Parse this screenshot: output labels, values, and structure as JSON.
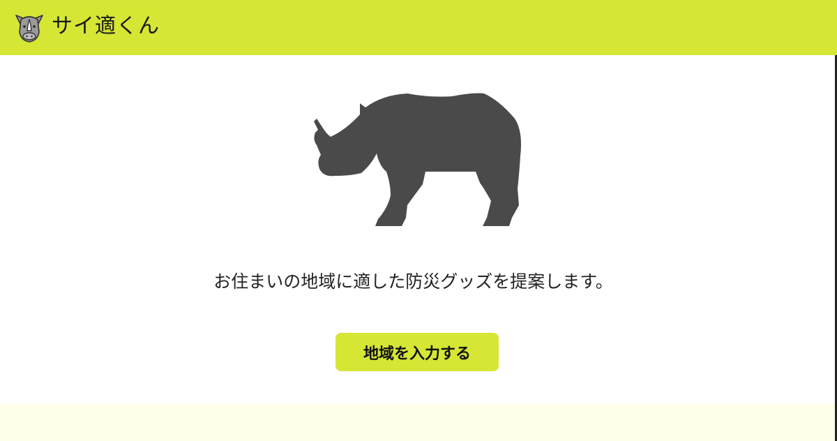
{
  "header": {
    "logo_icon": "rhino-face-icon",
    "title": "サイ適くん",
    "background_color": "#d5e635"
  },
  "hero": {
    "image_icon": "rhino-silhouette-icon",
    "image_color": "#4a4a4a"
  },
  "main": {
    "tagline": "お住まいの地域に適した防災グッズを提案します。",
    "cta_label": "地域を入力する",
    "cta_color": "#d5e635"
  },
  "bottom_section": {
    "background_color": "#fffee8"
  }
}
